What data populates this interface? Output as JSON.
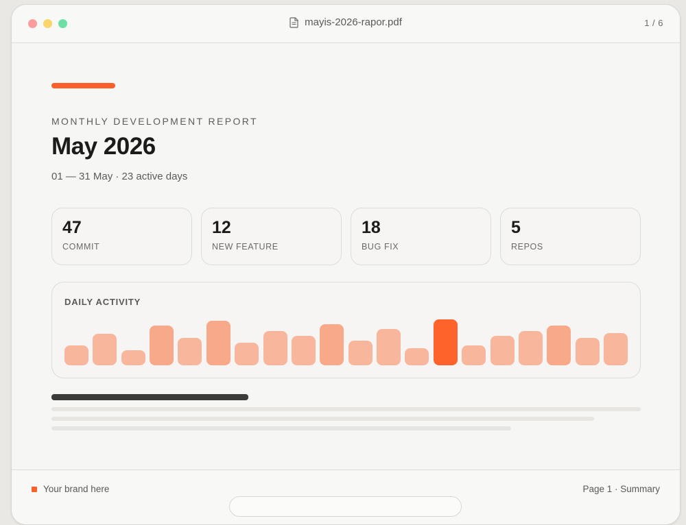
{
  "window": {
    "filename": "mayis-2026-rapor.pdf",
    "page_indicator": "1 / 6"
  },
  "report": {
    "eyebrow": "MONTHLY DEVELOPMENT REPORT",
    "title": "May 2026",
    "subtitle": "01 — 31 May · 23 active days"
  },
  "stats": [
    {
      "value": "47",
      "label": "COMMIT"
    },
    {
      "value": "12",
      "label": "NEW FEATURE"
    },
    {
      "value": "18",
      "label": "BUG FIX"
    },
    {
      "value": "5",
      "label": "REPOS"
    }
  ],
  "activity": {
    "title": "DAILY ACTIVITY",
    "levels": [
      0.43,
      0.69,
      0.33,
      0.86,
      0.6,
      0.97,
      0.49,
      0.74,
      0.64,
      0.9,
      0.53,
      0.79,
      0.38,
      1.0,
      0.44,
      0.64,
      0.74,
      0.86,
      0.6,
      0.7
    ],
    "highlight_index": 13,
    "colors": {
      "base": "#f8b79d",
      "strong": "#f7a98a",
      "highlight": "#fd632b"
    }
  },
  "footer": {
    "brand": "Your brand here",
    "page": "Page 1 · Summary"
  }
}
